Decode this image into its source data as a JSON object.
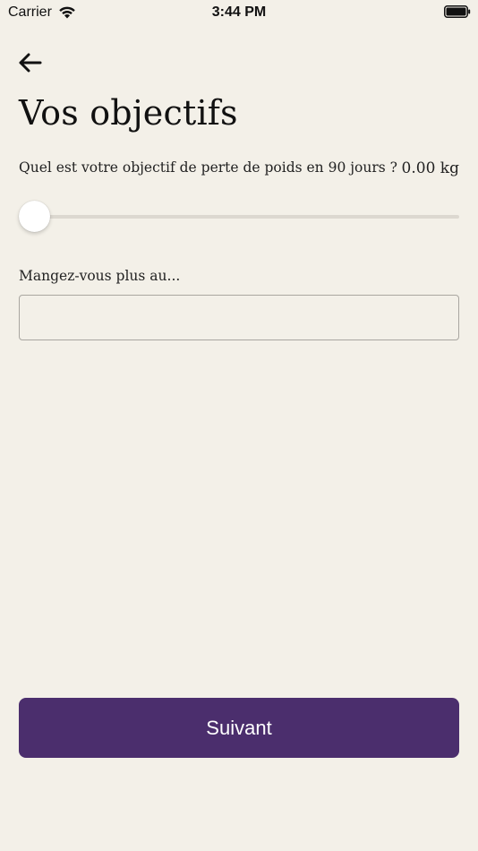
{
  "status_bar": {
    "carrier": "Carrier",
    "time": "3:44 PM",
    "wifi_icon": "wifi-icon",
    "battery_icon": "battery-icon"
  },
  "header": {
    "back_icon": "arrow-left-icon",
    "title": "Vos objectifs"
  },
  "weight_goal": {
    "question": "Quel est votre objectif de perte de poids en 90 jours ?",
    "value_text": "0.00 kg",
    "slider_fraction": 0
  },
  "eating": {
    "label": "Mangez-vous plus au...",
    "value": "",
    "placeholder": ""
  },
  "footer": {
    "next_label": "Suivant"
  },
  "colors": {
    "background": "#f3f0e8",
    "primary": "#4b2e6d",
    "track": "#dcd8d0"
  }
}
